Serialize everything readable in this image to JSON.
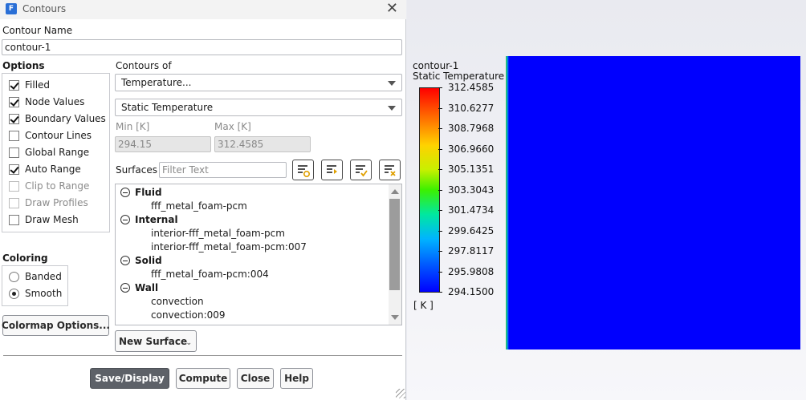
{
  "window": {
    "title": "Contours",
    "app_icon_letter": "F"
  },
  "contour_name": {
    "label": "Contour Name",
    "value": "contour-1"
  },
  "options": {
    "label": "Options",
    "items": [
      {
        "label": "Filled",
        "checked": true,
        "enabled": true
      },
      {
        "label": "Node Values",
        "checked": true,
        "enabled": true
      },
      {
        "label": "Boundary Values",
        "checked": true,
        "enabled": true
      },
      {
        "label": "Contour Lines",
        "checked": false,
        "enabled": true
      },
      {
        "label": "Global Range",
        "checked": false,
        "enabled": true
      },
      {
        "label": "Auto Range",
        "checked": true,
        "enabled": true
      },
      {
        "label": "Clip to Range",
        "checked": false,
        "enabled": false
      },
      {
        "label": "Draw Profiles",
        "checked": false,
        "enabled": false
      },
      {
        "label": "Draw Mesh",
        "checked": false,
        "enabled": true
      }
    ]
  },
  "contours_of": {
    "label": "Contours of",
    "category": "Temperature...",
    "quantity": "Static Temperature"
  },
  "range": {
    "min_label": "Min [K]",
    "min_value": "294.15",
    "max_label": "Max [K]",
    "max_value": "312.4585"
  },
  "surfaces": {
    "label": "Surfaces",
    "filter_placeholder": "Filter Text",
    "groups": [
      {
        "name": "Fluid",
        "items": [
          "fff_metal_foam-pcm"
        ]
      },
      {
        "name": "Internal",
        "items": [
          "interior-fff_metal_foam-pcm",
          "interior-fff_metal_foam-pcm:007"
        ]
      },
      {
        "name": "Solid",
        "items": [
          "fff_metal_foam-pcm:004"
        ]
      },
      {
        "name": "Wall",
        "items": [
          "convection",
          "convection:009"
        ]
      }
    ]
  },
  "coloring": {
    "label": "Coloring",
    "options": [
      {
        "label": "Banded",
        "selected": false
      },
      {
        "label": "Smooth",
        "selected": true
      }
    ]
  },
  "buttons": {
    "colormap": "Colormap Options...",
    "new_surface": "New Surface",
    "save_display": "Save/Display",
    "compute": "Compute",
    "close": "Close",
    "help": "Help"
  },
  "colorbar": {
    "title": "contour-1",
    "subtitle": "Static Temperature",
    "unit": "[ K ]",
    "ticks": [
      "312.4585",
      "310.6277",
      "308.7968",
      "306.9660",
      "305.1351",
      "303.3043",
      "301.4734",
      "299.6425",
      "297.8117",
      "295.9808",
      "294.1500"
    ],
    "colors": {
      "max": "#ff0000",
      "min": "#0000ff",
      "field": "#0000fe"
    }
  }
}
